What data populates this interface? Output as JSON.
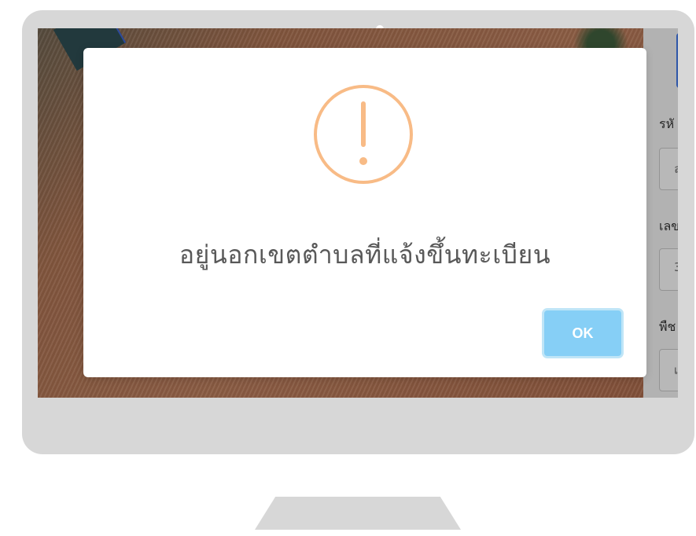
{
  "dialog": {
    "message": "อยู่นอกเขตตำบลที่แจ้งขึ้นทะเบียน",
    "ok_label": "OK",
    "icon": "warning-icon",
    "icon_color": "#f8bb86",
    "button_color": "#86cff6"
  },
  "side_panel": {
    "labels": [
      "รหั",
      "เลข",
      "พืช"
    ],
    "fields": [
      "ล",
      "3",
      "เ"
    ]
  },
  "map": {
    "type": "satellite imagery"
  }
}
